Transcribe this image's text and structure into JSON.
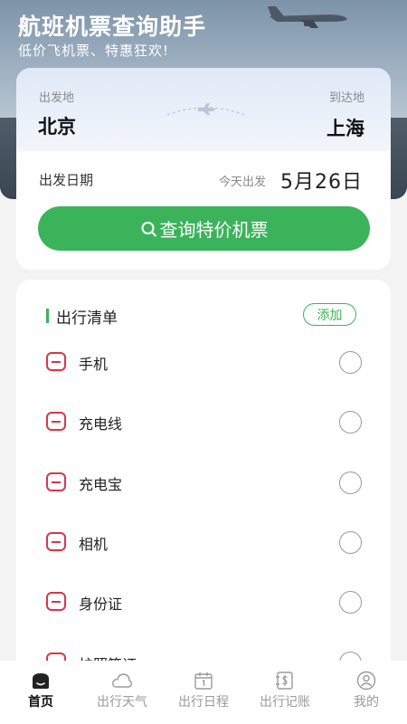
{
  "header": {
    "title": "航班机票查询助手",
    "subtitle": "低价飞机票、特惠狂欢!"
  },
  "search": {
    "from_label": "出发地",
    "to_label": "到达地",
    "from_city": "北京",
    "to_city": "上海",
    "date_label": "出发日期",
    "today_label": "今天出发",
    "date_value": "5月26日",
    "button_label": "查询特价机票"
  },
  "checklist": {
    "title": "出行清单",
    "add_label": "添加",
    "items": [
      {
        "label": "手机"
      },
      {
        "label": "充电线"
      },
      {
        "label": "充电宝"
      },
      {
        "label": "相机"
      },
      {
        "label": "身份证"
      },
      {
        "label": "护照签证"
      }
    ]
  },
  "tabbar": {
    "tabs": [
      {
        "label": "首页",
        "icon": "home-icon"
      },
      {
        "label": "出行天气",
        "icon": "cloud-icon"
      },
      {
        "label": "出行日程",
        "icon": "calendar-icon"
      },
      {
        "label": "出行记账",
        "icon": "bill-icon"
      },
      {
        "label": "我的",
        "icon": "user-icon"
      }
    ],
    "active_index": 0
  },
  "colors": {
    "accent": "#3bb35a",
    "delete": "#d8364a"
  }
}
